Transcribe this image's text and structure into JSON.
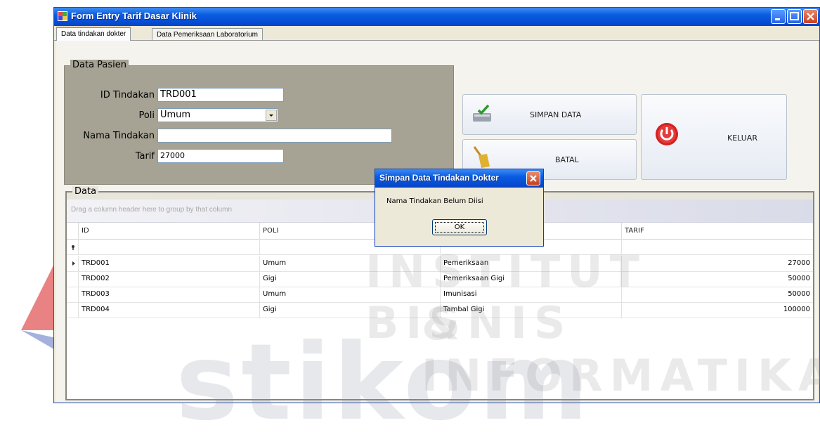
{
  "window": {
    "title": "Form Entry Tarif Dasar Klinik",
    "accent": "#0a5ce0"
  },
  "tabs": [
    {
      "label": "Data tindakan dokter",
      "active": true
    },
    {
      "label": "Data Pemeriksaan Laboratorium",
      "active": false
    }
  ],
  "pasien": {
    "group_label": "Data Pasien",
    "id_label": "ID Tindakan",
    "id_value": "TRD001",
    "poli_label": "Poli",
    "poli_value": "Umum",
    "nama_label": "Nama Tindakan",
    "nama_value": "",
    "tarif_label": "Tarif",
    "tarif_value": "27000"
  },
  "buttons": {
    "simpan": "SIMPAN DATA",
    "batal": "BATAL",
    "keluar": "KELUAR"
  },
  "data_group": {
    "label": "Data",
    "group_hint": "Drag a column header here to group by that column",
    "columns": [
      "ID",
      "POLI",
      "",
      "TARIF"
    ],
    "rows": [
      {
        "id": "TRD001",
        "poli": "Umum",
        "nama": "Pemeriksaan",
        "tarif": "27000"
      },
      {
        "id": "TRD002",
        "poli": "Gigi",
        "nama": "Pemeriksaan Gigi",
        "tarif": "50000"
      },
      {
        "id": "TRD003",
        "poli": "Umum",
        "nama": "Imunisasi",
        "tarif": "50000"
      },
      {
        "id": "TRD004",
        "poli": "Gigi",
        "nama": "Tambal Gigi",
        "tarif": "100000"
      }
    ]
  },
  "dialog": {
    "title": "Simpan Data Tindakan Dokter",
    "message": "Nama Tindakan Belum Diisi",
    "ok": "OK"
  },
  "watermark": {
    "line1": "INSTITUT BISNIS",
    "line2": "& INFORMATIKA",
    "line3": "stikom"
  }
}
